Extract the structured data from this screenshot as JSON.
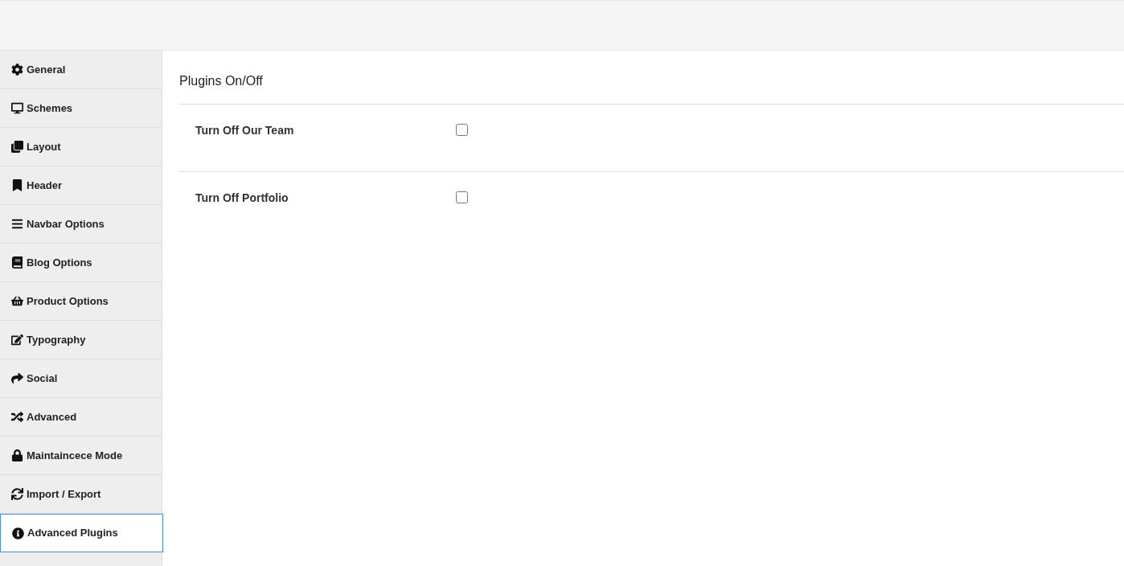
{
  "sidebar": {
    "items": [
      {
        "label": "General",
        "selected": false
      },
      {
        "label": "Schemes",
        "selected": false
      },
      {
        "label": "Layout",
        "selected": false
      },
      {
        "label": "Header",
        "selected": false
      },
      {
        "label": "Navbar Options",
        "selected": false
      },
      {
        "label": "Blog Options",
        "selected": false
      },
      {
        "label": "Product Options",
        "selected": false
      },
      {
        "label": "Typography",
        "selected": false
      },
      {
        "label": "Social",
        "selected": false
      },
      {
        "label": "Advanced",
        "selected": false
      },
      {
        "label": "Maintaincece Mode",
        "selected": false
      },
      {
        "label": "Import / Export",
        "selected": false
      },
      {
        "label": "Advanced Plugins",
        "selected": true
      }
    ]
  },
  "section": {
    "title": "Plugins On/Off",
    "options": [
      {
        "label": "Turn Off Our Team",
        "checked": false
      },
      {
        "label": "Turn Off Portfolio",
        "checked": false
      }
    ]
  }
}
